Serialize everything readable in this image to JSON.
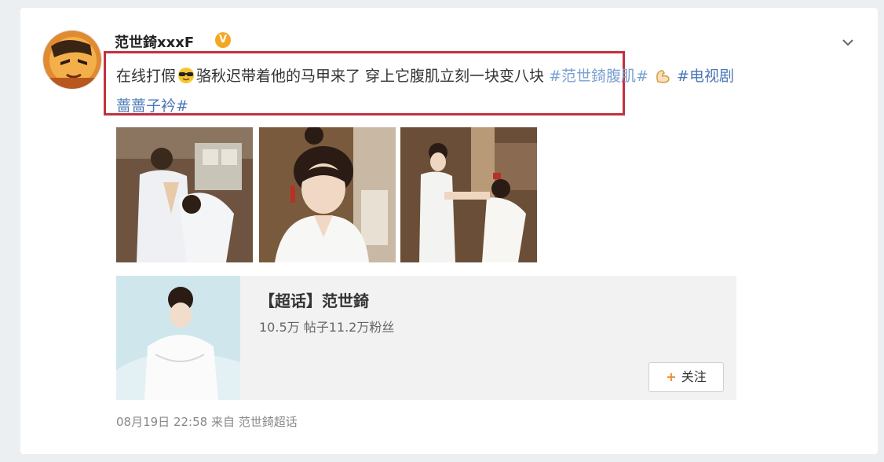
{
  "post": {
    "username": "范世錡xxxF",
    "verified_badge": "V",
    "text_part1": "在线打假",
    "text_part2": "骆秋迟带着他的马甲来了 穿上它腹肌立刻一块变八块",
    "tag1": "#范世錡腹肌#",
    "tag2": "#电视剧",
    "tag2_cont": "蔷蔷子衿#",
    "emoji1": "sunglasses-emoji",
    "emoji2": "biceps-emoji",
    "images": [
      "photo-1",
      "photo-2",
      "photo-3"
    ]
  },
  "super_topic": {
    "title": "【超话】范世錡",
    "stats": "10.5万 帖子11.2万粉丝",
    "follow_label": "关注",
    "follow_icon": "+"
  },
  "meta": {
    "timestamp": "08月19日 22:58",
    "source": "来自 范世錡超话"
  },
  "colors": {
    "highlight": "#c0323e",
    "link": "#4a78b5",
    "badge": "#f5a623",
    "accent": "#f08a2c"
  }
}
